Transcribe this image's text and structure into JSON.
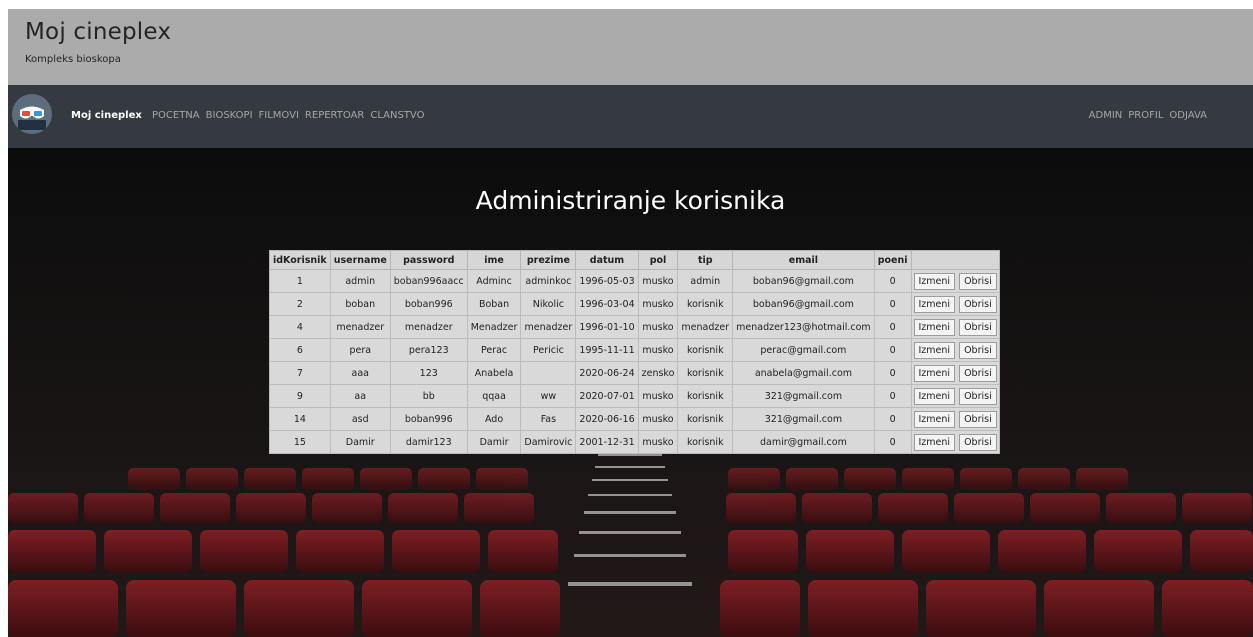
{
  "header": {
    "title": "Moj cineplex",
    "tagline": "Kompleks bioskopa"
  },
  "navbar": {
    "brand": "Moj cineplex",
    "logo_icon": "3d-glasses-icon",
    "left_links": [
      "POCETNA",
      "BIOSKOPI",
      "FILMOVI",
      "REPERTOAR",
      "CLANSTVO"
    ],
    "right_links": [
      "ADMIN",
      "PROFIL",
      "ODJAVA"
    ],
    "background": "#343a40"
  },
  "main": {
    "title": "Administriranje korisnika",
    "columns": [
      "idKorisnik",
      "username",
      "password",
      "ime",
      "prezime",
      "datum",
      "pol",
      "tip",
      "email",
      "poeni",
      ""
    ],
    "edit_label": "Izmeni",
    "delete_label": "Obrisi",
    "rows": [
      [
        "1",
        "admin",
        "boban996aacc",
        "Adminc",
        "adminkoc",
        "1996-05-03",
        "musko",
        "admin",
        "boban96@gmail.com",
        "0"
      ],
      [
        "2",
        "boban",
        "boban996",
        "Boban",
        "Nikolic",
        "1996-03-04",
        "musko",
        "korisnik",
        "boban96@gmail.com",
        "0"
      ],
      [
        "4",
        "menadzer",
        "menadzer",
        "Menadzer",
        "menadzer",
        "1996-01-10",
        "musko",
        "menadzer",
        "menadzer123@hotmail.com",
        "0"
      ],
      [
        "6",
        "pera",
        "pera123",
        "Perac",
        "Pericic",
        "1995-11-11",
        "musko",
        "korisnik",
        "perac@gmail.com",
        "0"
      ],
      [
        "7",
        "aaa",
        "123",
        "Anabela",
        "",
        "2020-06-24",
        "zensko",
        "korisnik",
        "anabela@gmail.com",
        "0"
      ],
      [
        "9",
        "aa",
        "bb",
        "qqaa",
        "ww",
        "2020-07-01",
        "musko",
        "korisnik",
        "321@gmail.com",
        "0"
      ],
      [
        "14",
        "asd",
        "boban996",
        "Ado",
        "Fas",
        "2020-06-16",
        "musko",
        "korisnik",
        "321@gmail.com",
        "0"
      ],
      [
        "15",
        "Damir",
        "damir123",
        "Damir",
        "Damirovic",
        "2001-12-31",
        "musko",
        "korisnik",
        "damir@gmail.com",
        "0"
      ]
    ]
  }
}
